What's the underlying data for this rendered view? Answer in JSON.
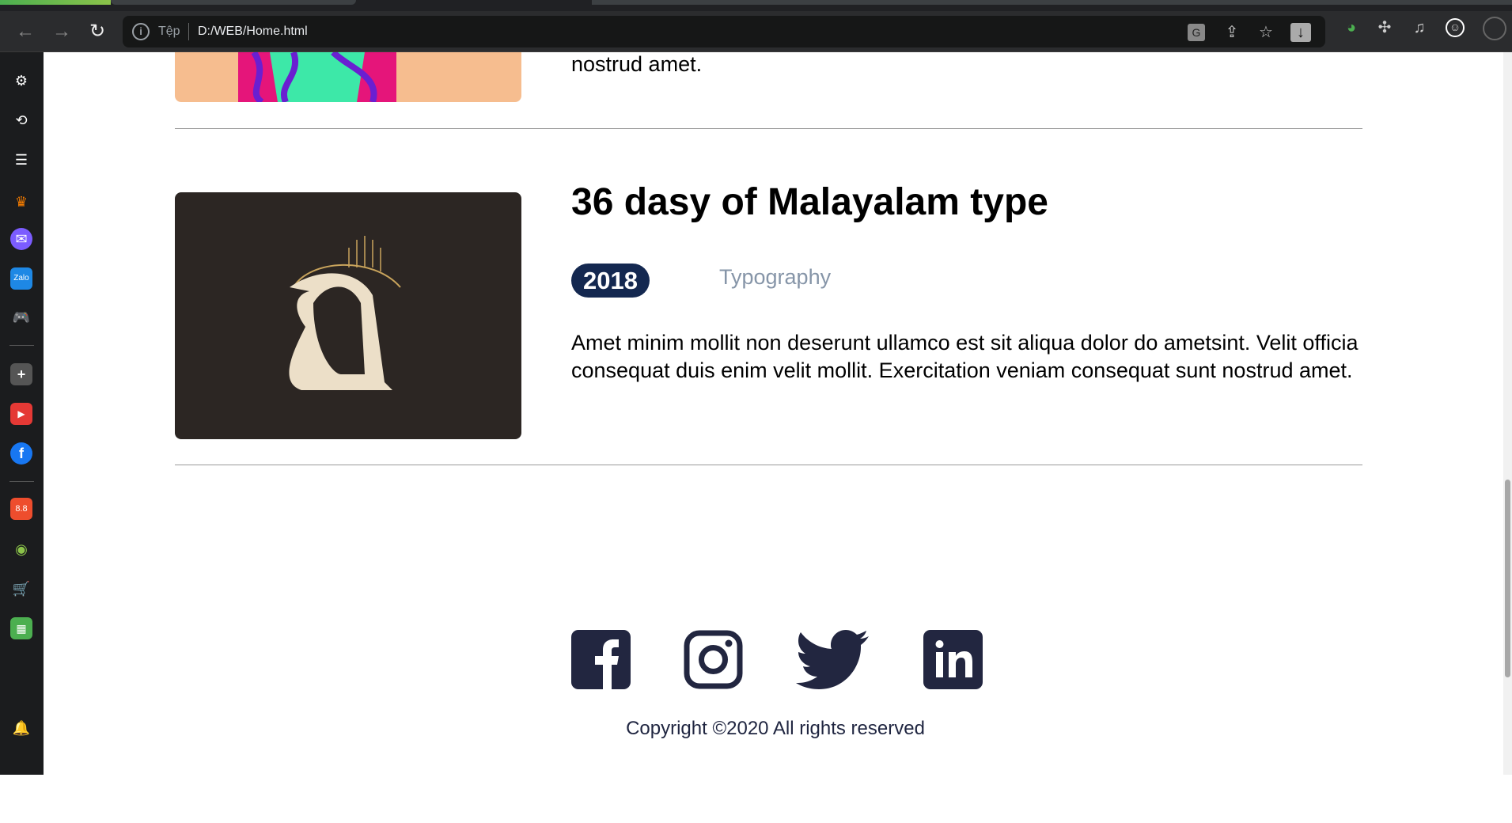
{
  "browser": {
    "scheme_label": "Tệp",
    "url": "D:/WEB/Home.html",
    "nav_icons": [
      "back-icon",
      "forward-icon",
      "reload-icon"
    ],
    "toolbar_icons": [
      "translate-icon",
      "share-icon",
      "bookmark-star-icon",
      "download-icon",
      "idm-icon",
      "extensions-icon",
      "media-icon",
      "profile-icon"
    ]
  },
  "sidebar": {
    "items": [
      "settings",
      "history",
      "reading-list",
      "crown",
      "messenger",
      "zalo",
      "games",
      "add",
      "youtube",
      "facebook",
      "shopee",
      "lazada-like",
      "tiki",
      "sheets",
      "notifications",
      "more"
    ]
  },
  "content": {
    "prev_item": {
      "text_tail": "nostrud amet."
    },
    "item": {
      "title": "36 dasy of Malayalam type",
      "year": "2018",
      "category": "Typography",
      "description": "Amet minim mollit non deserunt ullamco est sit aliqua dolor do ametsint. Velit officia consequat duis enim velit mollit. Exercitation veniam consequat sunt nostrud amet."
    }
  },
  "footer": {
    "social": [
      "facebook",
      "instagram",
      "twitter",
      "linkedin"
    ],
    "copyright": "Copyright ©2020 All rights reserved",
    "icon_color": "#222640"
  },
  "colors": {
    "badge": "#142850",
    "category": "#8695a8"
  }
}
